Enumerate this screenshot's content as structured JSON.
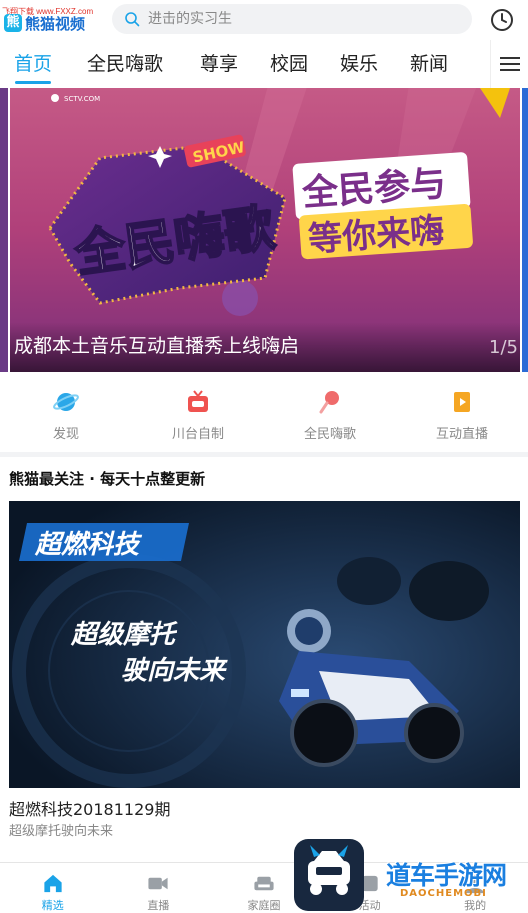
{
  "header": {
    "site_tag": "飞翔下载 www.FXXZ.com",
    "app_name": "熊猫视频",
    "search_placeholder": "进击的实习生"
  },
  "nav": {
    "tabs": [
      {
        "label": "首页",
        "active": true
      },
      {
        "label": "全民嗨歌",
        "active": false
      },
      {
        "label": "尊享",
        "active": false
      },
      {
        "label": "校园",
        "active": false
      },
      {
        "label": "娱乐",
        "active": false
      },
      {
        "label": "新闻",
        "active": false
      }
    ]
  },
  "banner": {
    "brand_text": "SCTV.COM",
    "show_badge": "SHOW",
    "main_title": "全民嗨歌",
    "slogan_line1": "全民参与",
    "slogan_line2": "等你来嗨",
    "caption": "成都本土音乐互动直播秀上线嗨启",
    "pager": "1/5"
  },
  "quick_entries": [
    {
      "label": "发现",
      "icon": "planet-icon",
      "color": "#2aa7e8"
    },
    {
      "label": "川台自制",
      "icon": "tv-icon",
      "color": "#ef5350"
    },
    {
      "label": "全民嗨歌",
      "icon": "microphone-icon",
      "color": "#ef6b6b"
    },
    {
      "label": "互动直播",
      "icon": "live-broadcast-icon",
      "color": "#f5a623"
    }
  ],
  "section": {
    "title": "熊猫最关注 · 每天十点整更新"
  },
  "video": {
    "thumb_title": "超燃科技",
    "thumb_line1": "超级摩托",
    "thumb_line2": "驶向未来",
    "title": "超燃科技20181129期",
    "subtitle": "超级摩托驶向未来"
  },
  "bottom_nav": [
    {
      "label": "精选",
      "icon": "home-icon",
      "active": true
    },
    {
      "label": "直播",
      "icon": "video-camera-icon",
      "active": false
    },
    {
      "label": "家庭圈",
      "icon": "sofa-icon",
      "active": false
    },
    {
      "label": "活动",
      "icon": "activity-icon",
      "active": false
    },
    {
      "label": "我的",
      "icon": "user-icon",
      "active": false
    }
  ],
  "watermark": {
    "text": "道车手游网",
    "sub": "DAOCHEMOBI"
  },
  "colors": {
    "accent": "#1aa3e8",
    "banner_bg": "#b8457a",
    "video_bg": "#0d1f35"
  }
}
